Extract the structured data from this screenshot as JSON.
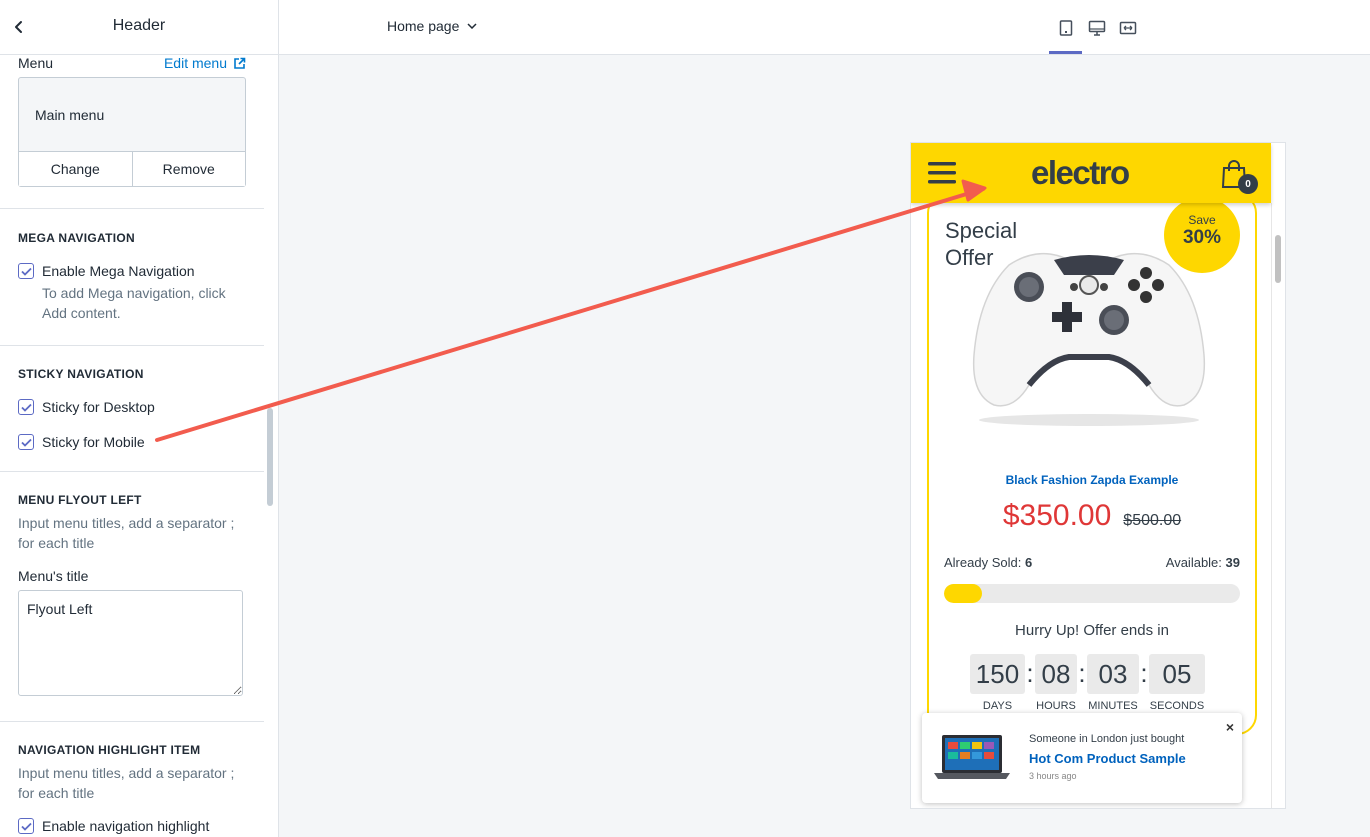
{
  "sidebar": {
    "title": "Header",
    "menu": {
      "label": "Menu",
      "edit_link": "Edit menu",
      "selected_menu": "Main menu",
      "change_button": "Change",
      "remove_button": "Remove"
    },
    "mega_navigation": {
      "heading": "MEGA NAVIGATION",
      "enable_label": "Enable Mega Navigation",
      "enable_checked": true,
      "help": "To add Mega navigation, click Add content."
    },
    "sticky_navigation": {
      "heading": "STICKY NAVIGATION",
      "desktop_label": "Sticky for Desktop",
      "desktop_checked": true,
      "mobile_label": "Sticky for Mobile",
      "mobile_checked": true
    },
    "menu_flyout_left": {
      "heading": "MENU FLYOUT LEFT",
      "help": "Input menu titles, add a separator ; for each title",
      "field_label": "Menu's title",
      "field_value": "Flyout Left"
    },
    "navigation_highlight": {
      "heading": "NAVIGATION HIGHLIGHT ITEM",
      "help": "Input menu titles, add a separator ; for each title",
      "enable_label": "Enable navigation highlight",
      "enable_checked": true
    }
  },
  "topbar": {
    "page_selector": "Home page",
    "views": [
      "mobile-view",
      "desktop-view",
      "fullscreen-view"
    ],
    "active_view": "mobile-view"
  },
  "preview": {
    "logo": "electro",
    "cart_count": "0",
    "deal": {
      "heading": "Special Offer",
      "save_label": "Save",
      "save_value": "30%",
      "product_title": "Black Fashion Zapda Example",
      "price": "$350.00",
      "old_price": "$500.00",
      "sold_label": "Already Sold:",
      "sold_value": "6",
      "available_label": "Available:",
      "available_value": "39",
      "sold_fraction": 0.13,
      "hurry_text": "Hurry Up! Offer ends in",
      "countdown": [
        {
          "value": "150",
          "label": "DAYS"
        },
        {
          "value": "08",
          "label": "HOURS"
        },
        {
          "value": "03",
          "label": "MINUTES"
        },
        {
          "value": "05",
          "label": "SECONDS"
        }
      ]
    },
    "notification": {
      "line1": "Someone in London just bought",
      "product": "Hot Com Product Sample",
      "time": "3 hours ago",
      "close": "×"
    }
  },
  "colors": {
    "brand_yellow": "#fed700",
    "price_red": "#df3737",
    "link_blue": "#0062bd",
    "admin_link": "#007ace",
    "accent_indigo": "#5c6ac4",
    "annotation_arrow": "#f25c4e"
  }
}
